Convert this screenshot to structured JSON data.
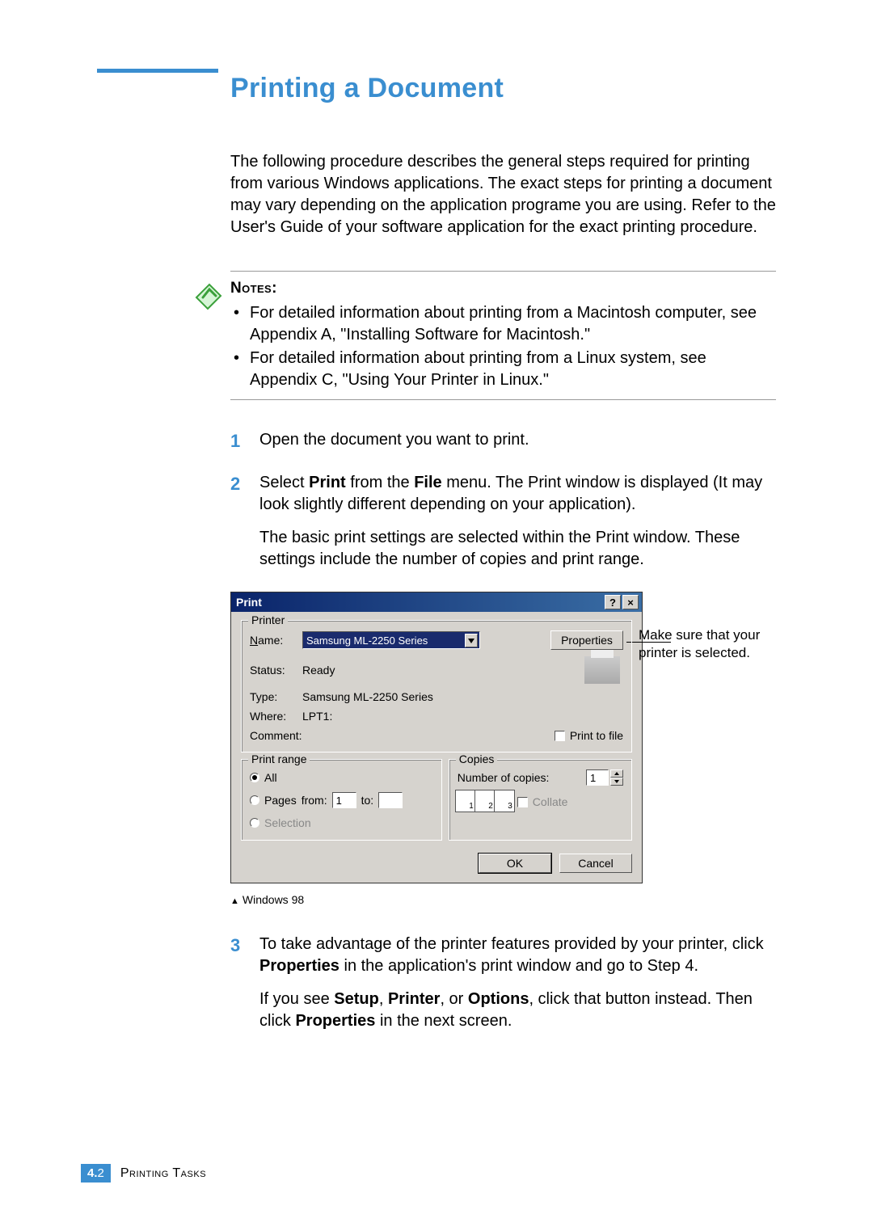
{
  "title": "Printing a Document",
  "intro": "The following procedure describes the general steps required for printing from various Windows applications. The exact steps for printing a document may vary depending on the application programe you are using. Refer to the User's Guide of your software application for the exact printing procedure.",
  "notesHeading": "Notes:",
  "notes": [
    "For detailed information about printing from a Macintosh computer, see Appendix A, \"Installing Software for Macintosh.\"",
    "For detailed information about printing from a Linux system, see Appendix C, \"Using Your Printer in Linux.\""
  ],
  "steps": {
    "s1": "Open the document you want to print.",
    "s2a_pre": "Select ",
    "s2a_print": "Print",
    "s2a_mid": " from the ",
    "s2a_file": "File",
    "s2a_post": " menu. The Print window is displayed (It may look slightly different depending on your application).",
    "s2b": "The basic print settings are selected within the Print window. These settings include the number of copies and print range.",
    "s3a_pre": "To take advantage of the printer features provided by your printer, click ",
    "s3a_props": "Properties",
    "s3a_post": " in the application's print window and go to Step 4.",
    "s3b_pre": "If you see ",
    "s3b_setup": "Setup",
    "s3b_c1": ", ",
    "s3b_printer": "Printer",
    "s3b_c2": ", or ",
    "s3b_options": "Options",
    "s3b_mid": ", click that button instead. Then click ",
    "s3b_props": "Properties",
    "s3b_post": " in the next screen."
  },
  "dialog": {
    "title": "Print",
    "help": "?",
    "close": "×",
    "printer": {
      "legend": "Printer",
      "nameLabel": "Name:",
      "nameValue": "Samsung ML-2250 Series",
      "propertiesBtn": "Properties",
      "statusLabel": "Status:",
      "statusValue": "Ready",
      "typeLabel": "Type:",
      "typeValue": "Samsung ML-2250 Series",
      "whereLabel": "Where:",
      "whereValue": "LPT1:",
      "commentLabel": "Comment:",
      "printToFile": "Print to file"
    },
    "range": {
      "legend": "Print range",
      "all": "All",
      "pages": "Pages",
      "fromLabel": "from:",
      "fromValue": "1",
      "toLabel": "to:",
      "toValue": "",
      "selection": "Selection"
    },
    "copies": {
      "legend": "Copies",
      "numLabel": "Number of copies:",
      "numValue": "1",
      "collate": "Collate"
    },
    "ok": "OK",
    "cancel": "Cancel"
  },
  "callout": "Make sure that your printer is selected.",
  "caption": "Windows 98",
  "footer": {
    "pageNum": "4.2",
    "section": "Printing Tasks"
  },
  "chart_data": null
}
